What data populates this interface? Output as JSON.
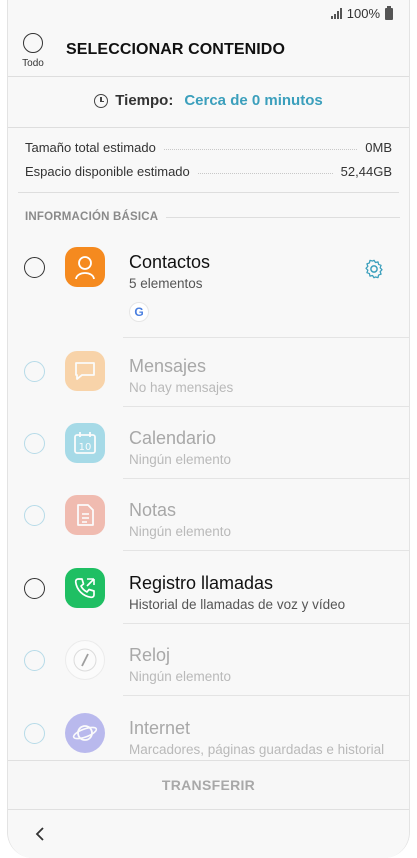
{
  "status_bar": {
    "battery": "100%"
  },
  "header": {
    "select_all_label": "Todo",
    "title": "SELECCIONAR CONTENIDO"
  },
  "time": {
    "label": "Tiempo:",
    "value": "Cerca de 0 minutos"
  },
  "sizes": [
    {
      "label": "Tamaño total estimado",
      "value": "0MB"
    },
    {
      "label": "Espacio disponible estimado",
      "value": "52,44GB"
    }
  ],
  "section": {
    "title": "INFORMACIÓN BÁSICA"
  },
  "items": [
    {
      "name": "Contactos",
      "sub": "5 elementos",
      "icon": "contacts-icon",
      "color": "#f58a1f",
      "enabled": true,
      "account_badge": "G"
    },
    {
      "name": "Mensajes",
      "sub": "No hay mensajes",
      "icon": "messages-icon",
      "color": "#f8a84a",
      "enabled": false
    },
    {
      "name": "Calendario",
      "sub": "Ningún elemento",
      "icon": "calendar-icon",
      "color": "#45b6d3",
      "enabled": false,
      "icon_text": "10"
    },
    {
      "name": "Notas",
      "sub": "Ningún elemento",
      "icon": "notes-icon",
      "color": "#e8735a",
      "enabled": false
    },
    {
      "name": "Registro llamadas",
      "sub": "Historial de llamadas de voz y vídeo",
      "icon": "call-log-icon",
      "color": "#1fbf63",
      "enabled": true
    },
    {
      "name": "Reloj",
      "sub": "Ningún elemento",
      "icon": "clock-app-icon",
      "color": "#ffffff",
      "enabled": false
    },
    {
      "name": "Internet",
      "sub": "Marcadores, páginas guardadas e historial",
      "icon": "internet-icon",
      "color": "#6f6fe0",
      "enabled": false
    }
  ],
  "footer": {
    "transfer_label": "TRANSFERIR"
  },
  "colors": {
    "accent": "#3b9fbc"
  }
}
